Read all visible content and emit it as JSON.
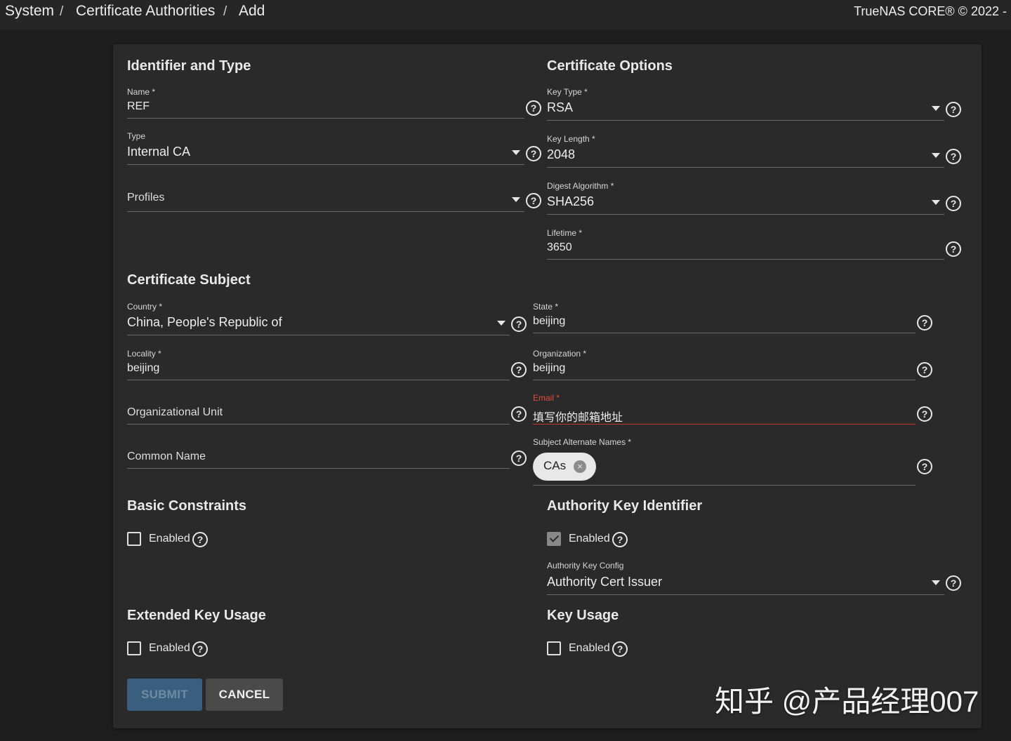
{
  "breadcrumb": {
    "system": "System",
    "sep1": "/",
    "ca": "Certificate Authorities",
    "sep2": "/",
    "add": "Add"
  },
  "copyright": "TrueNAS CORE® © 2022 -",
  "identifier": {
    "title": "Identifier and Type",
    "name_label": "Name *",
    "name_value": "REF",
    "type_label": "Type",
    "type_value": "Internal CA",
    "profiles_placeholder": "Profiles"
  },
  "options": {
    "title": "Certificate Options",
    "key_type_label": "Key Type *",
    "key_type_value": "RSA",
    "key_length_label": "Key Length *",
    "key_length_value": "2048",
    "digest_label": "Digest Algorithm *",
    "digest_value": "SHA256",
    "lifetime_label": "Lifetime *",
    "lifetime_value": "3650"
  },
  "subject": {
    "title": "Certificate Subject",
    "country_label": "Country *",
    "country_value": "China, People's Republic of",
    "state_label": "State *",
    "state_value": "beijing",
    "locality_label": "Locality *",
    "locality_value": "beijing",
    "organization_label": "Organization *",
    "organization_value": "beijing",
    "org_unit_placeholder": "Organizational Unit",
    "email_label": "Email *",
    "email_value": "填写你的邮箱地址",
    "common_name_placeholder": "Common Name",
    "san_label": "Subject Alternate Names *",
    "san_chip": "CAs"
  },
  "basic_constraints": {
    "title": "Basic Constraints",
    "enabled_label": "Enabled",
    "enabled": false
  },
  "authority_key": {
    "title": "Authority Key Identifier",
    "enabled_label": "Enabled",
    "enabled": true,
    "config_label": "Authority Key Config",
    "config_value": "Authority Cert Issuer"
  },
  "extended_key_usage": {
    "title": "Extended Key Usage",
    "enabled_label": "Enabled",
    "enabled": false
  },
  "key_usage": {
    "title": "Key Usage",
    "enabled_label": "Enabled",
    "enabled": false
  },
  "buttons": {
    "submit": "SUBMIT",
    "cancel": "CANCEL"
  },
  "help_glyph": "?",
  "close_glyph": "×",
  "watermark": "知乎 @产品经理007",
  "colors": {
    "background": "#1e1e1e",
    "card": "#2a2a2a",
    "error": "#e14a3c",
    "submit_disabled": "#3a5f7e"
  }
}
